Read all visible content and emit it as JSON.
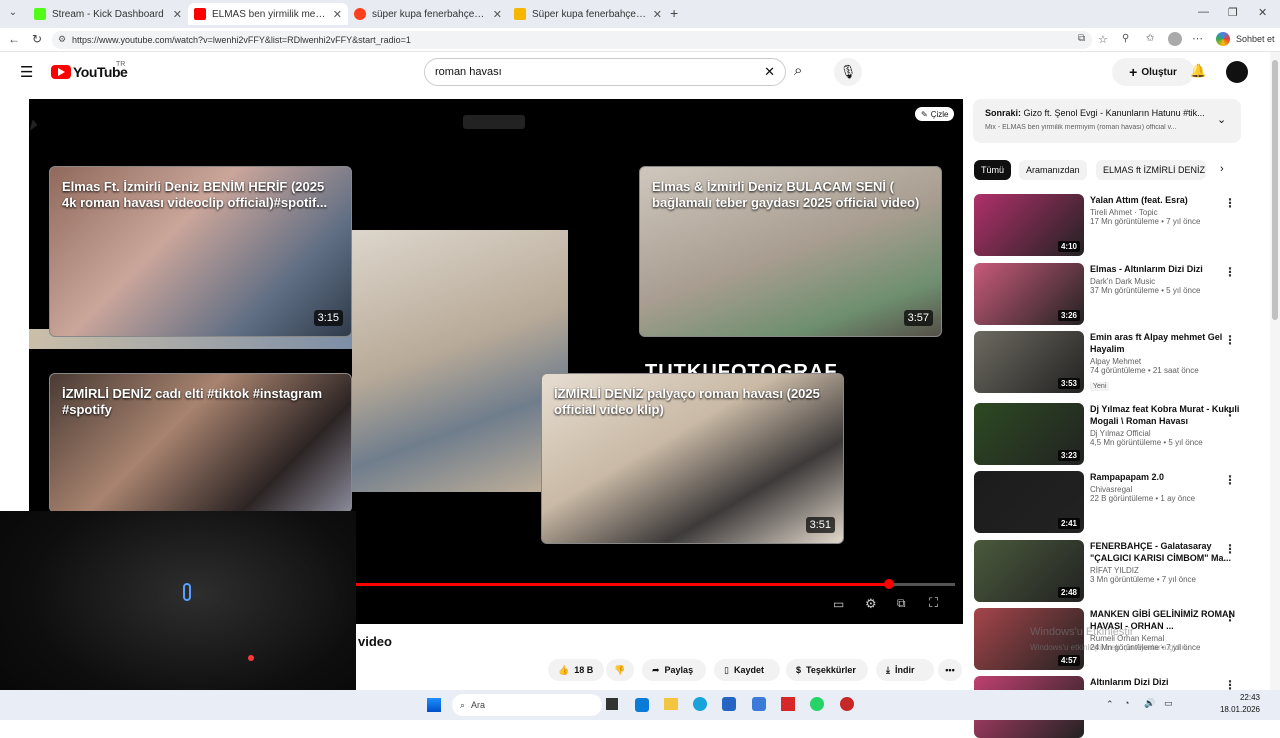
{
  "browser": {
    "tabs": [
      {
        "label": "Stream - Kick Dashboard",
        "color": "#53fc18"
      },
      {
        "label": "ELMAS ben yirmilik mermiyim (ro",
        "color": "#ff0000"
      },
      {
        "label": "süper kupa fenerbahçe — Yandex:",
        "color": "#fc3f1d"
      },
      {
        "label": "Süper kupa fenerbahçe Görselleri",
        "color": "#f6b700"
      }
    ],
    "new_tab": "+",
    "url": "https://www.youtube.com/watch?v=lwenhi2vFFY&list=RDlwenhi2vFFY&start_radio=1",
    "sohbet": "Sohbet et"
  },
  "youtube": {
    "logo": "YouTube",
    "country": "TR",
    "search_value": "roman havası",
    "create_label": "Oluştur"
  },
  "player": {
    "cizle_label": "Çizle",
    "overlay_brand": "TUTKUFOTOGRAF",
    "end_cards": [
      {
        "title": "Elmas Ft. İzmirli Deniz BENİM HERİF (2025 4k roman havası videoclip official)#spotif...",
        "duration": "3:15"
      },
      {
        "title": "Elmas & İzmirli Deniz BULACAM SENİ ( bağlamalı teber gaydası 2025 official video)",
        "duration": "3:57"
      },
      {
        "title": "İZMİRLİ DENİZ cadı elti #tiktok #instagram #spotify",
        "duration": ""
      },
      {
        "title": "İZMİRLİ DENİZ palyaço roman havası (2025 official video klip)",
        "duration": "3:51"
      }
    ],
    "progress": 0.89
  },
  "below_player": {
    "title_tail": "video",
    "likes": "18 B",
    "share": "Paylaş",
    "save": "Kaydet",
    "thanks": "Teşekkürler",
    "download": "İndir",
    "more": "•••"
  },
  "sidebar": {
    "next_label": "Sonraki:",
    "next_title": "Gizo ft. Şenol Evgi - Kanunların Hatunu #tik...",
    "mix_label": "Mix - ELMAS ben yirmilik mermiyim (roman havası) official v...",
    "chips": [
      "Tümü",
      "Aramanızdan",
      "ELMAS ft İZMİRLİ DENİZ"
    ],
    "videos": [
      {
        "title": "Yalan Attım (feat. Esra)",
        "channel": "Tireli Ahmet · Topic",
        "views": "17 Mn görüntüleme • 7 yıl önce",
        "duration": "4:10",
        "badge": "",
        "thumb": "#b0306a"
      },
      {
        "title": "Elmas - Altınlarım Dizi Dizi",
        "channel": "Dark'n Dark Music",
        "views": "37 Mn görüntüleme • 5 yıl önce",
        "duration": "3:26",
        "badge": "",
        "thumb": "#c85a7a"
      },
      {
        "title": "Emin aras ft Alpay mehmet  Gel Hayalim",
        "channel": "Alpay Mehmet",
        "views": "74 görüntüleme • 21 saat önce",
        "duration": "3:53",
        "badge": "Yeni",
        "thumb": "#6d6a60"
      },
      {
        "title": "Dj Yılmaz feat Kobra Murat - Kukuli Mogali \\ Roman Havası",
        "channel": "Dj Yılmaz Official",
        "views": "4,5 Mn görüntüleme • 5 yıl önce",
        "duration": "3:23",
        "badge": "",
        "thumb": "#2d4a22"
      },
      {
        "title": "Rampapapam 2.0",
        "channel": "Chivasregal",
        "views": "22 B görüntüleme • 1 ay önce",
        "duration": "2:41",
        "badge": "",
        "thumb": "#1c1c1c"
      },
      {
        "title": "FENERBAHÇE - Galatasaray \"ÇALGICI KARISI CİMBOM\" Ma...",
        "channel": "RİFAT YILDIZ",
        "views": "3 Mn görüntüleme • 7 yıl önce",
        "duration": "2:48",
        "badge": "",
        "thumb": "#4a5a3c"
      },
      {
        "title": "MANKEN GİBİ GELİNİMİZ ROMAN HAVASI - ORHAN ...",
        "channel": "Rumeli Orhan Kemal",
        "views": "24 Mn görüntüleme • 7 yıl önce",
        "duration": "4:57",
        "badge": "",
        "thumb": "#a5454a"
      },
      {
        "title": "Altınlarım Dizi Dizi",
        "channel": "",
        "views": "",
        "duration": "",
        "badge": "",
        "thumb": "#c04070"
      }
    ]
  },
  "watermark": {
    "line1": "Windows'u Etkinleştir",
    "line2": "Windows'u etkinleştirmek için Ayarlar'a gidin."
  },
  "taskbar": {
    "search": "Ara",
    "time": "22:43",
    "date": "18.01.2026"
  }
}
